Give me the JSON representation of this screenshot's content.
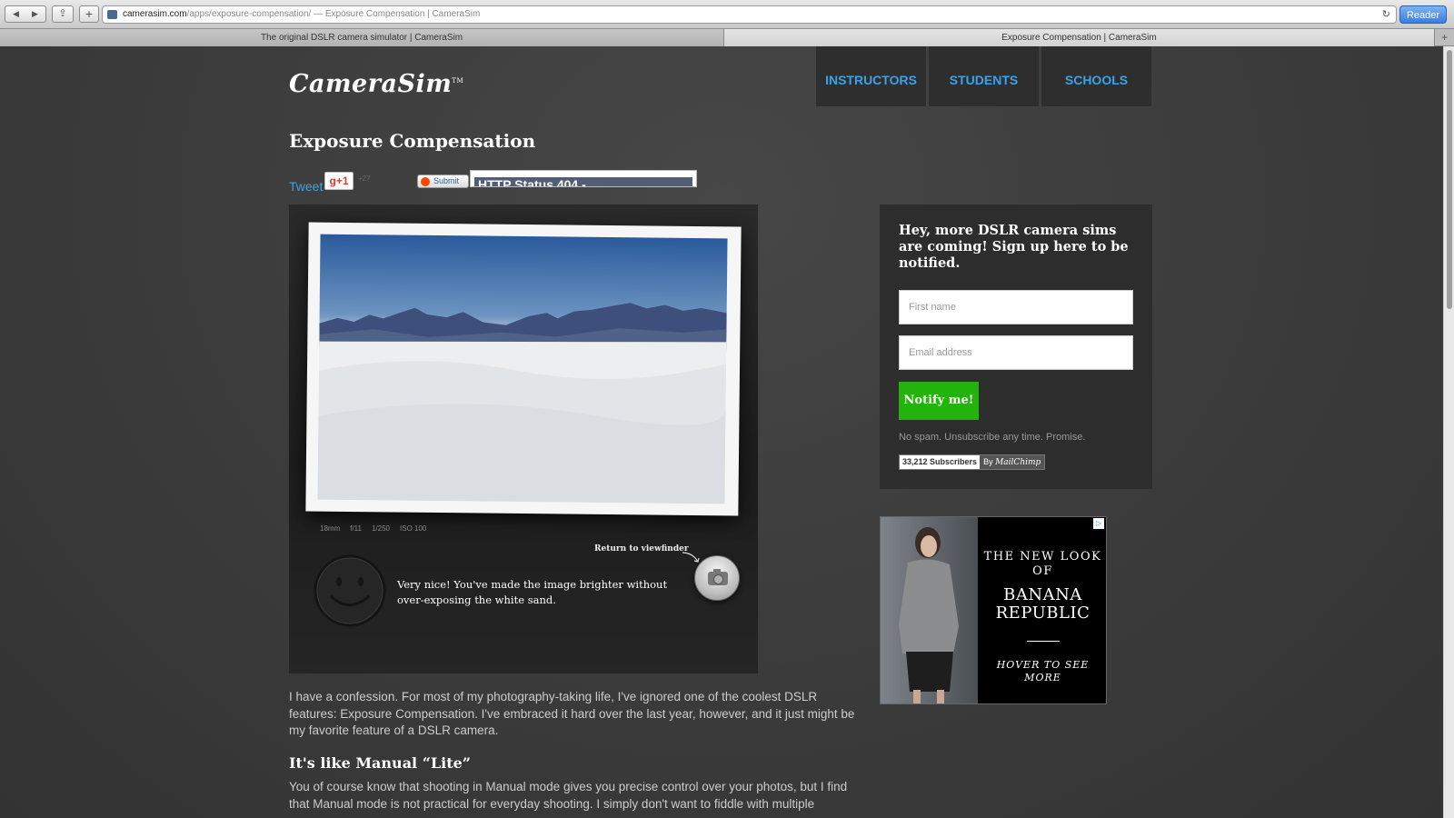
{
  "browser": {
    "url_host": "camerasim.com",
    "url_path": "/apps/exposure-compensation/",
    "url_title": " — Exposure Compensation | CameraSim",
    "reader_label": "Reader",
    "tabs": [
      {
        "label": "The original DSLR camera simulator | CameraSim"
      },
      {
        "label": "Exposure Compensation | CameraSim"
      }
    ]
  },
  "site": {
    "logo": "CameraSim",
    "logo_tm": "TM",
    "nav": [
      {
        "label": "INSTRUCTORS"
      },
      {
        "label": "STUDENTS"
      },
      {
        "label": "SCHOOLS"
      }
    ]
  },
  "page": {
    "title": "Exposure Compensation",
    "social": {
      "tweet": "Tweet",
      "gplus": "g+1",
      "gplus_count": "+27",
      "submit": "Submit",
      "frame_text": "HTTP Status 404 -"
    }
  },
  "simulator": {
    "exif": [
      "18mm",
      "f/11",
      "1/250",
      "ISO 100"
    ],
    "return_label": "Return to viewfinder",
    "message": "Very nice! You've made the image brighter without over-exposing the white sand."
  },
  "article": {
    "intro": "I have a confession. For most of my photography-taking life, I've ignored one of the coolest DSLR features: Exposure Compensation. I've embraced it hard over the last year, however, and it just might be my favorite feature of a DSLR camera.",
    "heading": "It's like Manual “Lite”",
    "para2": "You of course know that shooting in Manual mode gives you precise control over your photos, but I find that Manual mode is not practical for everyday shooting. I simply don't want to fiddle with multiple"
  },
  "signup": {
    "title": "Hey, more DSLR camera sims are coming! Sign up here to be notified.",
    "first_name_placeholder": "First name",
    "email_placeholder": "Email address",
    "button": "Notify me!",
    "nospam": "No spam. Unsubscribe any time. Promise.",
    "subscribers": "33,212 Subscribers",
    "by": "By",
    "provider": "MailChimp"
  },
  "ad": {
    "line1": "THE NEW LOOK OF",
    "line2": "BANANA REPUBLIC",
    "line3": "HOVER TO SEE MORE",
    "adchoice": "▷"
  },
  "colors": {
    "accent_link": "#3aa2e8",
    "notify_green": "#23b30c",
    "page_bg": "#3a3a3a"
  }
}
